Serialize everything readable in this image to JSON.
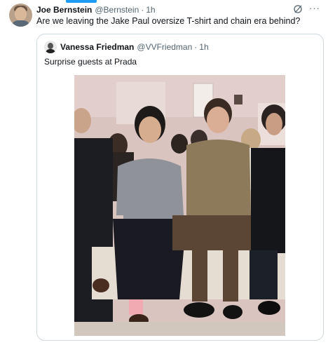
{
  "tweet": {
    "author_name": "Joe Bernstein",
    "author_handle": "@Bernstein",
    "separator": "·",
    "time": "1h",
    "text": "Are we leaving the Jake Paul oversize T-shirt and chain era behind?",
    "more_label": "···"
  },
  "quote": {
    "author_name": "Vanessa Friedman",
    "author_handle": "@VVFriedman",
    "separator": "·",
    "time": "1h",
    "text": "Surprise guests at Prada"
  },
  "colors": {
    "accent": "#1d9bf0",
    "secondary_text": "#536471",
    "border": "#cfd9de"
  },
  "icons": [
    "grok-icon",
    "more-icon"
  ]
}
